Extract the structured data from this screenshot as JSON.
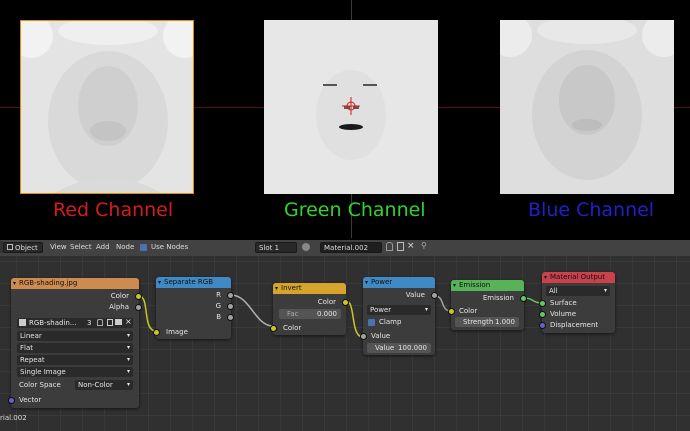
{
  "captions": {
    "red": "Red Channel",
    "green": "Green Channel",
    "blue": "Blue Channel",
    "colors": {
      "red": "#d41d1d",
      "green": "#2dd52d",
      "blue": "#2020c9"
    }
  },
  "header": {
    "mode": "Object",
    "menu": [
      "View",
      "Select",
      "Add",
      "Node"
    ],
    "use_nodes_label": "Use Nodes",
    "use_nodes_checked": true,
    "slot": "Slot 1",
    "material_name": "Material.002",
    "users": "",
    "icons": [
      "editor-type-icon",
      "sphere-icon",
      "duplicate-icon",
      "close-icon",
      "pin-icon"
    ]
  },
  "nodes": {
    "image_texture": {
      "title": "RGB-shading.jpg",
      "outputs": [
        "Color",
        "Alpha"
      ],
      "image_name": "RGB-shadin...",
      "users": "3",
      "interpolation": "Linear",
      "projection": "Flat",
      "extension": "Repeat",
      "source": "Single Image",
      "color_space_label": "Color Space",
      "color_space": "Non-Color",
      "input": "Vector"
    },
    "separate_rgb": {
      "title": "Separate RGB",
      "outputs": [
        "R",
        "G",
        "B"
      ],
      "input": "Image"
    },
    "invert": {
      "title": "Invert",
      "output": "Color",
      "fac_label": "Fac",
      "fac_value": "0.000",
      "input": "Color"
    },
    "power": {
      "title": "Power",
      "output": "Value",
      "operation": "Power",
      "clamp_label": "Clamp",
      "clamp_checked": true,
      "input": "Value",
      "value_label": "Value",
      "value_value": "100.000"
    },
    "emission": {
      "title": "Emission",
      "output": "Emission",
      "input": "Color",
      "strength_label": "Strength",
      "strength_value": "1.000"
    },
    "material_output": {
      "title": "Material Output",
      "target": "All",
      "inputs": [
        "Surface",
        "Volume",
        "Displacement"
      ]
    }
  },
  "footer_label": "rial.002",
  "node_colors": {
    "input": "#ce8b4f",
    "converter": "#3f89c4",
    "color": "#d6a42d",
    "shader": "#57b357",
    "output": "#c9414a"
  }
}
